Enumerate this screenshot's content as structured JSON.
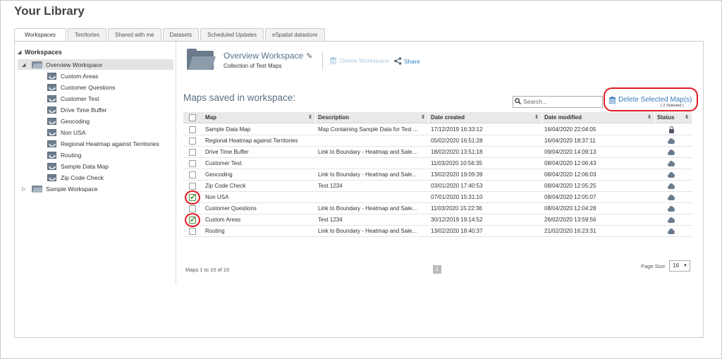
{
  "page": {
    "title": "Your Library"
  },
  "tabs": [
    {
      "label": "Workspaces",
      "active": true
    },
    {
      "label": "Territories",
      "active": false
    },
    {
      "label": "Shared with me",
      "active": false
    },
    {
      "label": "Datasets",
      "active": false
    },
    {
      "label": "Scheduled Updates",
      "active": false
    },
    {
      "label": "eSpatial datastore",
      "active": false
    }
  ],
  "tree": {
    "root_label": "Workspaces",
    "workspaces": [
      {
        "label": "Overview Workspace",
        "expanded": true,
        "selected": true,
        "maps": [
          "Custom Areas",
          "Customer Questions",
          "Customer Test",
          "Drive Time Buffer",
          "Geocoding",
          "Non USA",
          "Regional Heatmap against Territories",
          "Routing",
          "Sample Data Map",
          "Zip Code Check"
        ]
      },
      {
        "label": "Sample Workspace",
        "expanded": false,
        "selected": false,
        "maps": []
      }
    ]
  },
  "workspace_header": {
    "name": "Overview Workspace",
    "description": "Collection of Test Maps",
    "delete_label": "Delete Workspace",
    "share_label": "Share"
  },
  "maps_section": {
    "title": "Maps saved in workspace:",
    "search_placeholder": "Search...",
    "delete_selected_label": "Delete Selected Map(s)",
    "selected_count_label": "( 2 Selected )"
  },
  "table": {
    "columns": [
      "Map",
      "Description",
      "Date created",
      "Date modified",
      "Status"
    ],
    "rows": [
      {
        "map": "Sample Data Map",
        "description": "Map Containing Sample Data for Test ...",
        "created": "17/12/2019 16:33:12",
        "modified": "16/04/2020 22:04:05",
        "status": "lock",
        "checked": false
      },
      {
        "map": "Regional Heatmap against Territories",
        "description": "",
        "created": "05/02/2020 16:51:28",
        "modified": "16/04/2020 18:37:11",
        "status": "cloud",
        "checked": false
      },
      {
        "map": "Drive Time Buffer",
        "description": "Link to Boundary - Heatmap and Sale...",
        "created": "18/02/2020 13:51:18",
        "modified": "09/04/2020 14:09:13",
        "status": "cloud",
        "checked": false
      },
      {
        "map": "Customer Test",
        "description": "",
        "created": "11/03/2020 10:56:35",
        "modified": "08/04/2020 12:06:43",
        "status": "cloud",
        "checked": false
      },
      {
        "map": "Geocoding",
        "description": "Link to Boundary - Heatmap and Sale...",
        "created": "13/02/2020 19:09:39",
        "modified": "08/04/2020 12:06:03",
        "status": "cloud",
        "checked": false
      },
      {
        "map": "Zip Code Check",
        "description": "Test 1234",
        "created": "03/01/2020 17:40:53",
        "modified": "08/04/2020 12:05:25",
        "status": "cloud",
        "checked": false
      },
      {
        "map": "Non USA",
        "description": "",
        "created": "07/01/2020 15:31:10",
        "modified": "08/04/2020 12:05:07",
        "status": "cloud",
        "checked": true
      },
      {
        "map": "Customer Questions",
        "description": "Link to Boundary - Heatmap and Sale...",
        "created": "11/03/2020 15:22:36",
        "modified": "08/04/2020 12:04:28",
        "status": "cloud",
        "checked": false
      },
      {
        "map": "Custom Areas",
        "description": "Test 1234",
        "created": "30/12/2019 19:14:52",
        "modified": "26/02/2020 13:59:56",
        "status": "cloud",
        "checked": true
      },
      {
        "map": "Routing",
        "description": "Link to Boundary - Heatmap and Sale...",
        "created": "13/02/2020 18:40:37",
        "modified": "21/02/2020 16:23:31",
        "status": "cloud",
        "checked": false
      }
    ]
  },
  "pager": {
    "summary": "Maps 1 to 10 of 10",
    "current_page": "1",
    "page_size_label": "Page Size",
    "page_size_value": "16"
  },
  "colors": {
    "link": "#2a83c5",
    "highlight_ring": "#e01a22",
    "title": "#5b7083"
  }
}
